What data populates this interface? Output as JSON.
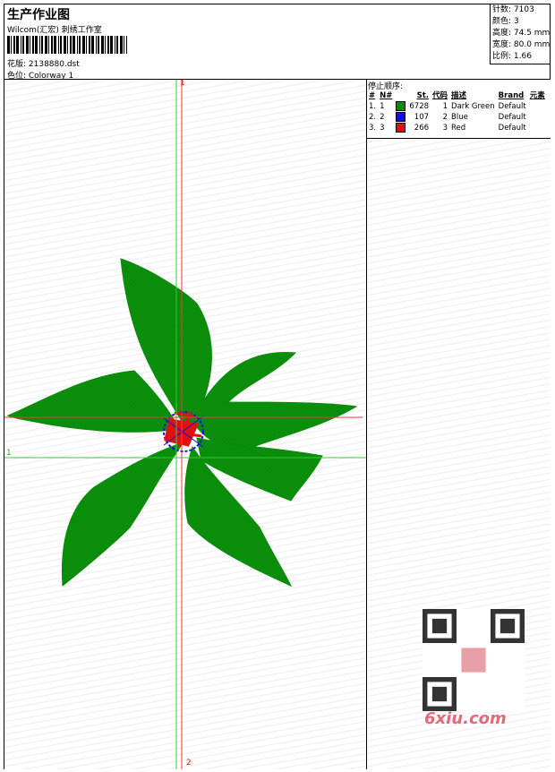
{
  "header": {
    "title": "生产作业图",
    "company": "Wilcom(汇宏) 刺绣工作室",
    "file": "花版: 2138880.dst",
    "colorway": "色位: Colorway 1"
  },
  "stats": {
    "stitches": "针数: 7103",
    "colors": "颜色: 3",
    "height": "高度: 74.5 mm",
    "width": "宽度: 80.0 mm",
    "ratio": "比例: 1.66"
  },
  "legend": {
    "title": "停止顺序:",
    "columns": [
      "#",
      "N#",
      "St.",
      "代码",
      "描述",
      "Brand",
      "元素"
    ],
    "rows": [
      {
        "idx": "1.",
        "n": "1",
        "color": "#0a8a0a",
        "st": "6728",
        "code": "1",
        "desc": "Dark Green",
        "brand": "Default"
      },
      {
        "idx": "2.",
        "n": "2",
        "color": "#1010e0",
        "st": "107",
        "code": "2",
        "desc": "Blue",
        "brand": "Default"
      },
      {
        "idx": "3.",
        "n": "3",
        "color": "#e01010",
        "st": "266",
        "code": "3",
        "desc": "Red",
        "brand": "Default"
      }
    ]
  },
  "canvas": {
    "axis_label_top": "1",
    "axis_label_bottom": "2",
    "axis_label_left": "1"
  },
  "watermark": {
    "site": "6xiu.com"
  },
  "colors": {
    "green": "#0a8a0a",
    "blue": "#1010e0",
    "red": "#e01010",
    "guide_green": "#33cc33",
    "guide_red": "#ff3333"
  }
}
